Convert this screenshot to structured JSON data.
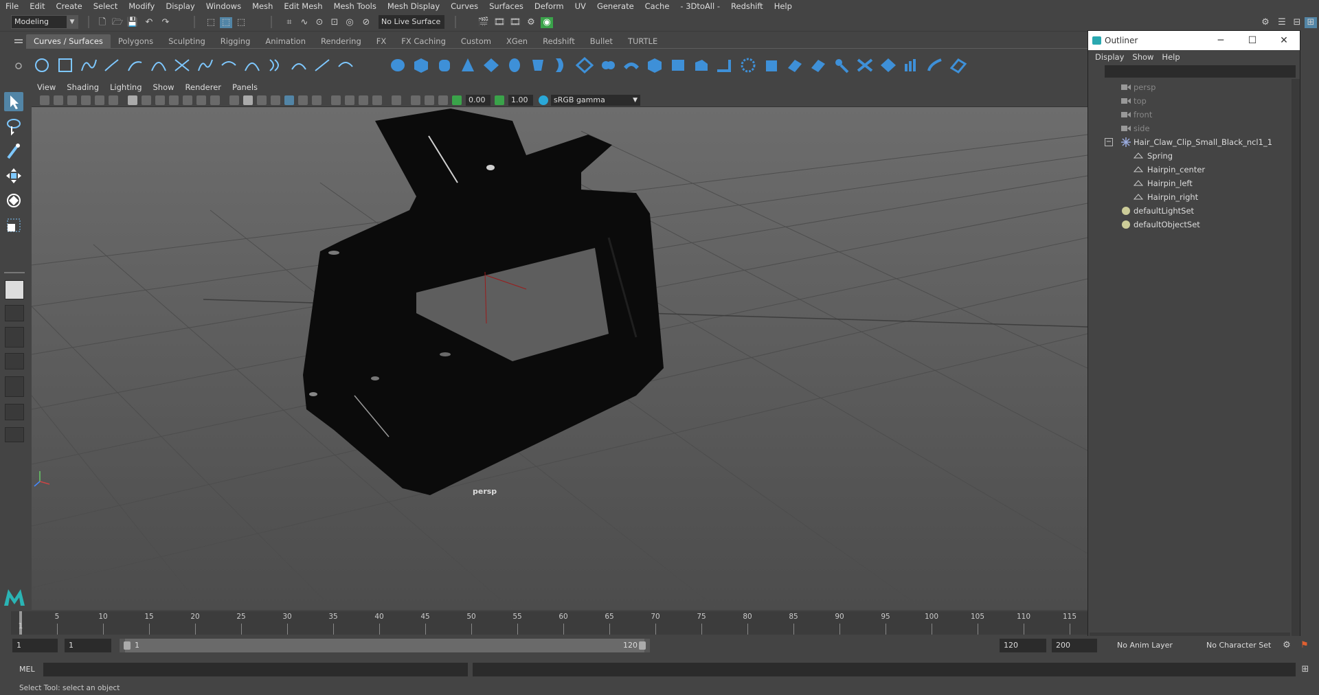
{
  "menubar": [
    "File",
    "Edit",
    "Create",
    "Select",
    "Modify",
    "Display",
    "Windows",
    "Mesh",
    "Edit Mesh",
    "Mesh Tools",
    "Mesh Display",
    "Curves",
    "Surfaces",
    "Deform",
    "UV",
    "Generate",
    "Cache",
    "- 3DtoAll -",
    "Redshift",
    "Help"
  ],
  "status": {
    "mode": "Modeling",
    "live_surface": "No Live Surface"
  },
  "shelf_tabs": [
    "Curves / Surfaces",
    "Polygons",
    "Sculpting",
    "Rigging",
    "Animation",
    "Rendering",
    "FX",
    "FX Caching",
    "Custom",
    "XGen",
    "Redshift",
    "Bullet",
    "TURTLE"
  ],
  "viewport": {
    "menu": [
      "View",
      "Shading",
      "Lighting",
      "Show",
      "Renderer",
      "Panels"
    ],
    "exposure": "0.00",
    "gamma": "1.00",
    "colorspace": "sRGB gamma",
    "camera_label": "persp"
  },
  "outliner": {
    "title": "Outliner",
    "menu": [
      "Display",
      "Show",
      "Help"
    ],
    "cameras": [
      "persp",
      "top",
      "front",
      "side"
    ],
    "group": "Hair_Claw_Clip_Small_Black_ncl1_1",
    "children": [
      "Spring",
      "Hairpin_center",
      "Hairpin_left",
      "Hairpin_right"
    ],
    "sets": [
      "defaultLightSet",
      "defaultObjectSet"
    ],
    "window_controls": {
      "minimize": "─",
      "maximize": "☐",
      "close": "✕"
    }
  },
  "timeline": {
    "ticks": [
      "5",
      "10",
      "15",
      "20",
      "25",
      "30",
      "35",
      "40",
      "45",
      "50",
      "55",
      "60",
      "65",
      "70",
      "75",
      "80",
      "85",
      "90",
      "95",
      "100",
      "105",
      "110",
      "115"
    ],
    "current_frame": "1"
  },
  "range": {
    "start": "1",
    "playback_start": "1",
    "slider_start": "1",
    "slider_end": "120",
    "playback_end": "120",
    "end": "200",
    "anim_layer": "No Anim Layer",
    "character_set": "No Character Set"
  },
  "cmdline": {
    "label": "MEL"
  },
  "helpline": "Select Tool: select an object"
}
